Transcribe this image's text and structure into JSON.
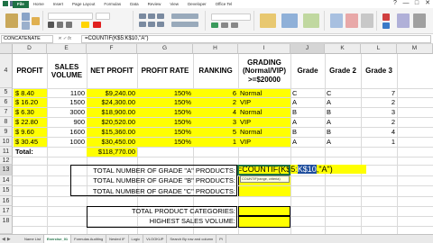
{
  "ribbon": {
    "tabs": [
      "File",
      "Home",
      "Insert",
      "Page Layout",
      "Formulas",
      "Data",
      "Review",
      "View",
      "Developer",
      "Office Tel"
    ]
  },
  "window": {
    "controls": [
      "?",
      "—",
      "□",
      "✕"
    ]
  },
  "formula_bar": {
    "name_box": "CONCATENATE",
    "fx_label": "✕ ✓ fx",
    "formula": "=COUNTIF(K$5:K$10,\"A\")"
  },
  "columns": [
    "D",
    "E",
    "F",
    "G",
    "H",
    "I",
    "J",
    "K",
    "L",
    "M"
  ],
  "rows": [
    "4",
    "5",
    "6",
    "7",
    "8",
    "9",
    "10",
    "11",
    "12",
    "13",
    "14",
    "15",
    "16",
    "17",
    "18"
  ],
  "headers": {
    "profit": "PROFIT",
    "sales_volume": "SALES VOLUME",
    "net_profit": "NET PROFIT",
    "profit_rate": "PROFIT RATE",
    "ranking": "RANKING",
    "grading": "GRADING (Normal/VIP) >=$20000",
    "grade": "Grade",
    "grade2": "Grade 2",
    "grade3": "Grade 3"
  },
  "data_rows": [
    {
      "profit": "$   8.40",
      "volume": "1100",
      "net": "$9,240.00",
      "rate": "150%",
      "rank": "6",
      "grading": "Normal",
      "grade": "C",
      "grade2": "C",
      "grade3": "7"
    },
    {
      "profit": "$  16.20",
      "volume": "1500",
      "net": "$24,300.00",
      "rate": "150%",
      "rank": "2",
      "grading": "VIP",
      "grade": "A",
      "grade2": "A",
      "grade3": "2"
    },
    {
      "profit": "$   6.30",
      "volume": "3000",
      "net": "$18,900.00",
      "rate": "150%",
      "rank": "4",
      "grading": "Normal",
      "grade": "B",
      "grade2": "B",
      "grade3": "3"
    },
    {
      "profit": "$  22.80",
      "volume": "900",
      "net": "$20,520.00",
      "rate": "150%",
      "rank": "3",
      "grading": "VIP",
      "grade": "A",
      "grade2": "A",
      "grade3": "2"
    },
    {
      "profit": "$   9.60",
      "volume": "1600",
      "net": "$15,360.00",
      "rate": "150%",
      "rank": "5",
      "grading": "Normal",
      "grade": "B",
      "grade2": "B",
      "grade3": "4"
    },
    {
      "profit": "$  30.45",
      "volume": "1000",
      "net": "$30,450.00",
      "rate": "150%",
      "rank": "1",
      "grading": "VIP",
      "grade": "A",
      "grade2": "A",
      "grade3": "1"
    }
  ],
  "total": {
    "label": "Total:",
    "net": "$118,770.00"
  },
  "summary": {
    "grade_a": "TOTAL NUMBER OF GRADE \"A\" PRODUCTS:",
    "grade_b": "TOTAL NUMBER OF GRADE \"B\" PRODUCTS:",
    "grade_c": "TOTAL NUMBER OF GRADE \"C\" PRODUCTS:",
    "categories": "TOTAL PRODUCT CATEGORIES:",
    "highest": "HIGHEST SALES VOLUME:"
  },
  "editing": {
    "before": "=COUNTIF(K$5",
    "selected": "K$10",
    "after": ",\"A\")",
    "tooltip": "COUNTIF(range, criteria)"
  },
  "sheet_tabs": [
    "Name List",
    "Exercise_01",
    "Formulas Auditing",
    "Nested IF",
    "Logic",
    "VLOOKUP",
    "Search By row and column",
    "Pi"
  ],
  "active_sheet_index": 1,
  "tab_nav": [
    "◀",
    "▶"
  ],
  "colors": {
    "accent": "#1e7145",
    "highlight": "#ffff00",
    "selection": "#1f4e9d"
  }
}
